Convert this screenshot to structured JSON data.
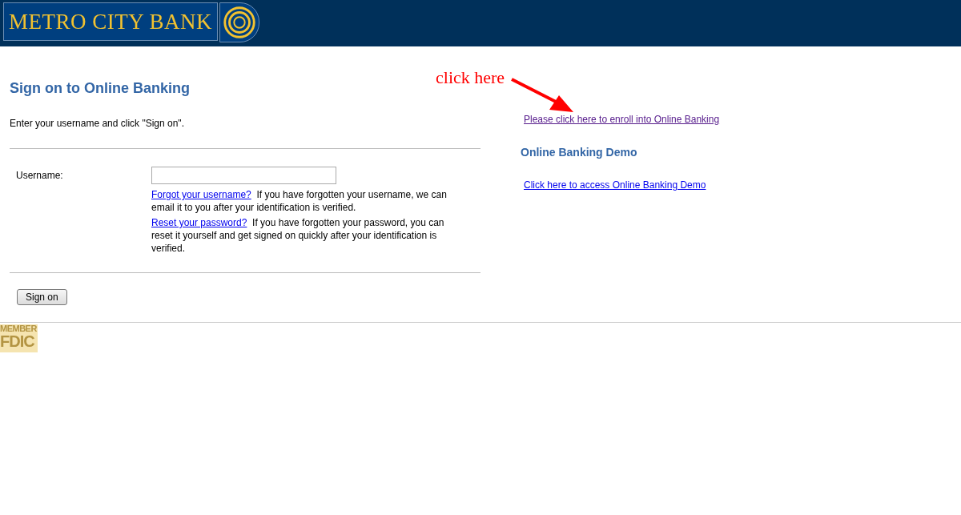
{
  "header": {
    "logo_text": "METRO CITY BANK"
  },
  "signon": {
    "title": "Sign on to Online Banking",
    "instruction": "Enter your username and click \"Sign on\".",
    "username_label": "Username:",
    "help": [
      {
        "link": "Forgot your username?",
        "text": "If you have forgotten your username, we can email it to you after your identification is verified."
      },
      {
        "link": "Reset your password?",
        "text": "If you have forgotten your password, you can reset it yourself and get signed on quickly after your identification is verified."
      }
    ],
    "button": "Sign on"
  },
  "enroll": {
    "link": "Please click here to enroll into Online Banking",
    "visited": true
  },
  "demo": {
    "title": "Online Banking Demo",
    "link": "Click here to access Online Banking Demo",
    "visited": false
  },
  "annotation": {
    "text": "click here"
  },
  "footer": {
    "badge_top": "MEMBER",
    "badge_bottom": "FDIC"
  }
}
